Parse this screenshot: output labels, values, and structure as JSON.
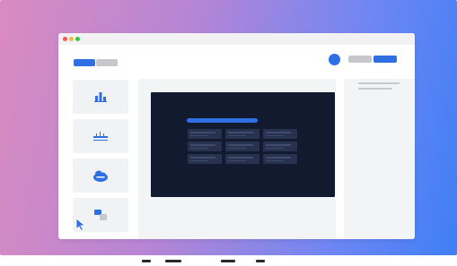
{
  "window": {
    "title_dots": [
      "red",
      "yellow",
      "green"
    ]
  },
  "icons": {
    "sidebar": [
      "bar-chart-icon",
      "ruler-icon",
      "abc-cloud-icon",
      "comment-icon"
    ]
  },
  "sidebar": {
    "items": [
      {
        "name": "sidebar-item-chart",
        "icon": "bar-chart-icon"
      },
      {
        "name": "sidebar-item-measure",
        "icon": "ruler-icon"
      },
      {
        "name": "sidebar-item-abc",
        "icon": "abc-cloud-icon",
        "badge": "ABC"
      },
      {
        "name": "sidebar-item-comment",
        "icon": "comment-icon"
      }
    ]
  },
  "colors": {
    "accent": "#2f6fe4",
    "dark_card": "#121a30",
    "gradient_start": "#d98bc0",
    "gradient_end": "#3f7ff5"
  }
}
